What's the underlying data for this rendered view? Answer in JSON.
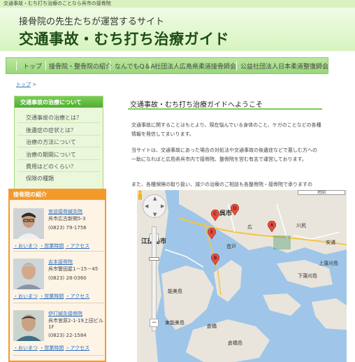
{
  "topbar": {
    "text": "交通事故・むち打ち治療のことなら呉市の接骨院"
  },
  "header": {
    "subtitle": "接骨院の先生たちが運営するサイト",
    "title": "交通事故・むち打ち治療ガイド"
  },
  "nav": {
    "items": [
      {
        "label": "トップ"
      },
      {
        "label": "接骨院・整骨院の紹介"
      },
      {
        "label": "なんでもQ＆A"
      },
      {
        "label": "社団法人広島県柔道接骨師会"
      },
      {
        "label": "公益社団法人日本柔道整復師会"
      }
    ]
  },
  "breadcrumb": {
    "label": "トップ",
    "sep": ">"
  },
  "sidenav": {
    "heading": "交通事故の治療について",
    "items": [
      {
        "label": "交通事故の治療とは？"
      },
      {
        "label": "後遺症の症状とは？"
      },
      {
        "label": "治療の方法について"
      },
      {
        "label": "治療の期間について"
      },
      {
        "label": "費用はどのくらい？"
      },
      {
        "label": "保険の種類"
      }
    ]
  },
  "main": {
    "title": "交通事故・むち打ち治療ガイドへようこそ",
    "paragraphs": [
      "交通事故に関することはもとより、現在悩んでいる身体のこと、ケガのことなどの各種情報を発信してまいります。",
      "当サイトは、交通事故にあった場合の対処法や交通事故の後遺症などで悪しむ方への一助になればと広島県呉市内で接骨院、整骨院を営む有志で運営しております。",
      "また、各種保険の取り扱い、減少の治療のご相談も各整骨院・接骨院で承りますの"
    ]
  },
  "clinics": {
    "heading": "接骨院の紹介",
    "link_access": "・アクセス",
    "link_hours": "・営業時間",
    "link_map": "・おいまつ",
    "items": [
      {
        "name": "宮迫接骨鍼灸院",
        "address": "呉市広古新開5-3",
        "tel": "(0823) 79-1756"
      },
      {
        "name": "吉本接骨院",
        "address": "呉市警固屋1－15－45",
        "tel": "(0823) 28-0360"
      },
      {
        "name": "伊打鍼灸接骨院",
        "address": "呉市宮原2-1-19上田ビル1F",
        "tel": "(0823) 22-1584"
      }
    ]
  },
  "map": {
    "labels": {
      "city_kure": "呉市",
      "city_etajima": "江田島市",
      "shimo_kamagari": "下蒲刈島",
      "kamikamagari": "上蒲刈島",
      "kurahashi": "倉橋島",
      "nomi": "能美島",
      "kurahashi_town": "倉橋",
      "tono": "東能美島",
      "hiro": "広",
      "kawajiri": "川尻",
      "yasuura": "安浦",
      "ondo": "音戸"
    },
    "markers": [
      "A",
      "B",
      "C",
      "D",
      "E"
    ],
    "mode_label": "地図"
  }
}
